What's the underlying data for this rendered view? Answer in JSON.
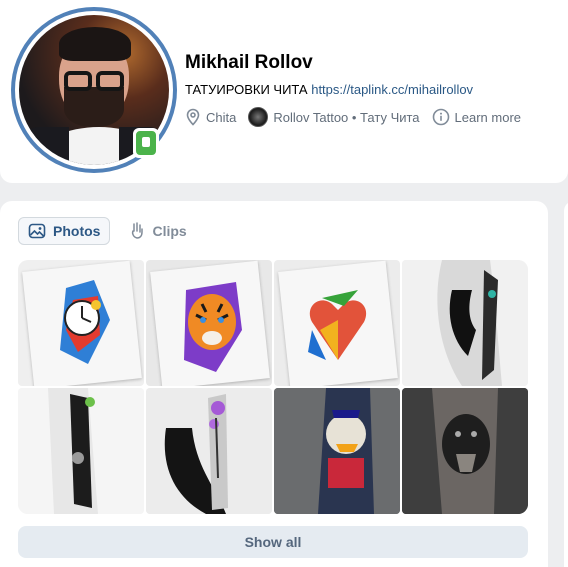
{
  "profile": {
    "name": "Mikhail Rollov",
    "status_text": "ТАТУИРОВКИ ЧИТА",
    "status_link": "https://taplink.cc/mihailrollov",
    "location": "Chita",
    "group": "Rollov Tattoo • Тату Чита",
    "learn_more": "Learn more",
    "online": "mobile"
  },
  "media": {
    "tabs": [
      {
        "label": "Photos",
        "icon": "image-icon",
        "active": true
      },
      {
        "label": "Clips",
        "icon": "clips-icon",
        "active": false
      }
    ],
    "photos": [
      "clock-tattoo-sketch",
      "tiger-tattoo-sketch",
      "heart-tattoo-sketch",
      "sleeve-tattoo-on-model",
      "arm-tattoo-back",
      "floral-sleeve-on-model",
      "cartoon-duck-tattoo-forearm",
      "gorilla-tattoo-forearm"
    ],
    "show_all": "Show all"
  },
  "colors": {
    "accent": "#5181b8",
    "link": "#2a5885",
    "online": "#4bb34b",
    "muted_text": "#626d7a"
  }
}
